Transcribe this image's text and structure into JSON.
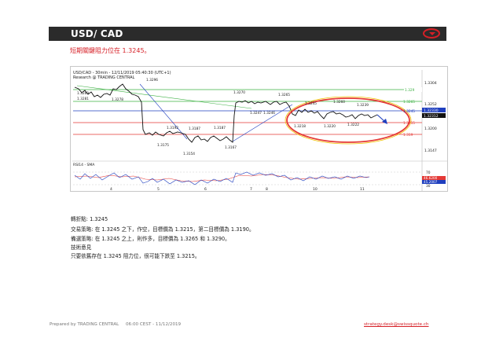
{
  "header": {
    "title": "USD/ CAD",
    "menu_icon": "chevron-down-icon",
    "accent": "#d61f26"
  },
  "subtitle": "短期關鍵阻力位在  1.3245。",
  "chart": {
    "title": "USD/CAD - 30min - 12/11/2019 05:40:30 (UTC+1)",
    "source": "Research @ TRADING CENTRAL",
    "indicator_label": "RSI14 - SMA",
    "price_ticks": [
      "1.3304",
      "1.3252",
      "1.3200",
      "1.3147"
    ],
    "level_tags": [
      "1.329",
      "1.3265",
      "1.3245",
      "1.32330",
      "1.32312",
      "1.3215",
      "1.319"
    ],
    "rsi_ticks": [
      "70",
      "30"
    ],
    "rsi_tags": [
      "46.6200",
      "45.2007"
    ],
    "time_ticks": [
      "4",
      "5",
      "6",
      "7",
      "8",
      "10",
      "11"
    ],
    "annotations": [
      "1.3296",
      "1.3269",
      "1.3281",
      "1.3278",
      "1.3192",
      "1.3187",
      "1.3175",
      "1.3154",
      "1.3187",
      "1.3167",
      "1.3270",
      "1.3247",
      "1.3246",
      "1.3265",
      "1.3245",
      "1.3260",
      "1.3239",
      "1.3218",
      "1.3220",
      "1.3222"
    ],
    "colors": {
      "resistance": "#3cb043",
      "support": "#e53935",
      "pivot": "#1f3fbf",
      "highlight": "#e53935",
      "fill": "#f2c200"
    }
  },
  "body": {
    "pivot_label": "轉折點: 1.3245",
    "strategy": "交易策略: 在     1.3245 之下，作空，目標價為  1.3215，第二目標價為 1.3190。",
    "alternative": "備選策略: 在     1.3245 之上，則作多，目標價為 1.3265 和 1.3290。",
    "comment_title": "技術意見",
    "comment": "只要依舊存在 1.3245 阻力位，很可能下跌至  1.3215。"
  },
  "footer": {
    "prepared": "Prepared by TRADING CENTRAL",
    "time": "06:00 CEST - 11/12/2019",
    "email": "strategy.desk@swissquote.ch"
  }
}
